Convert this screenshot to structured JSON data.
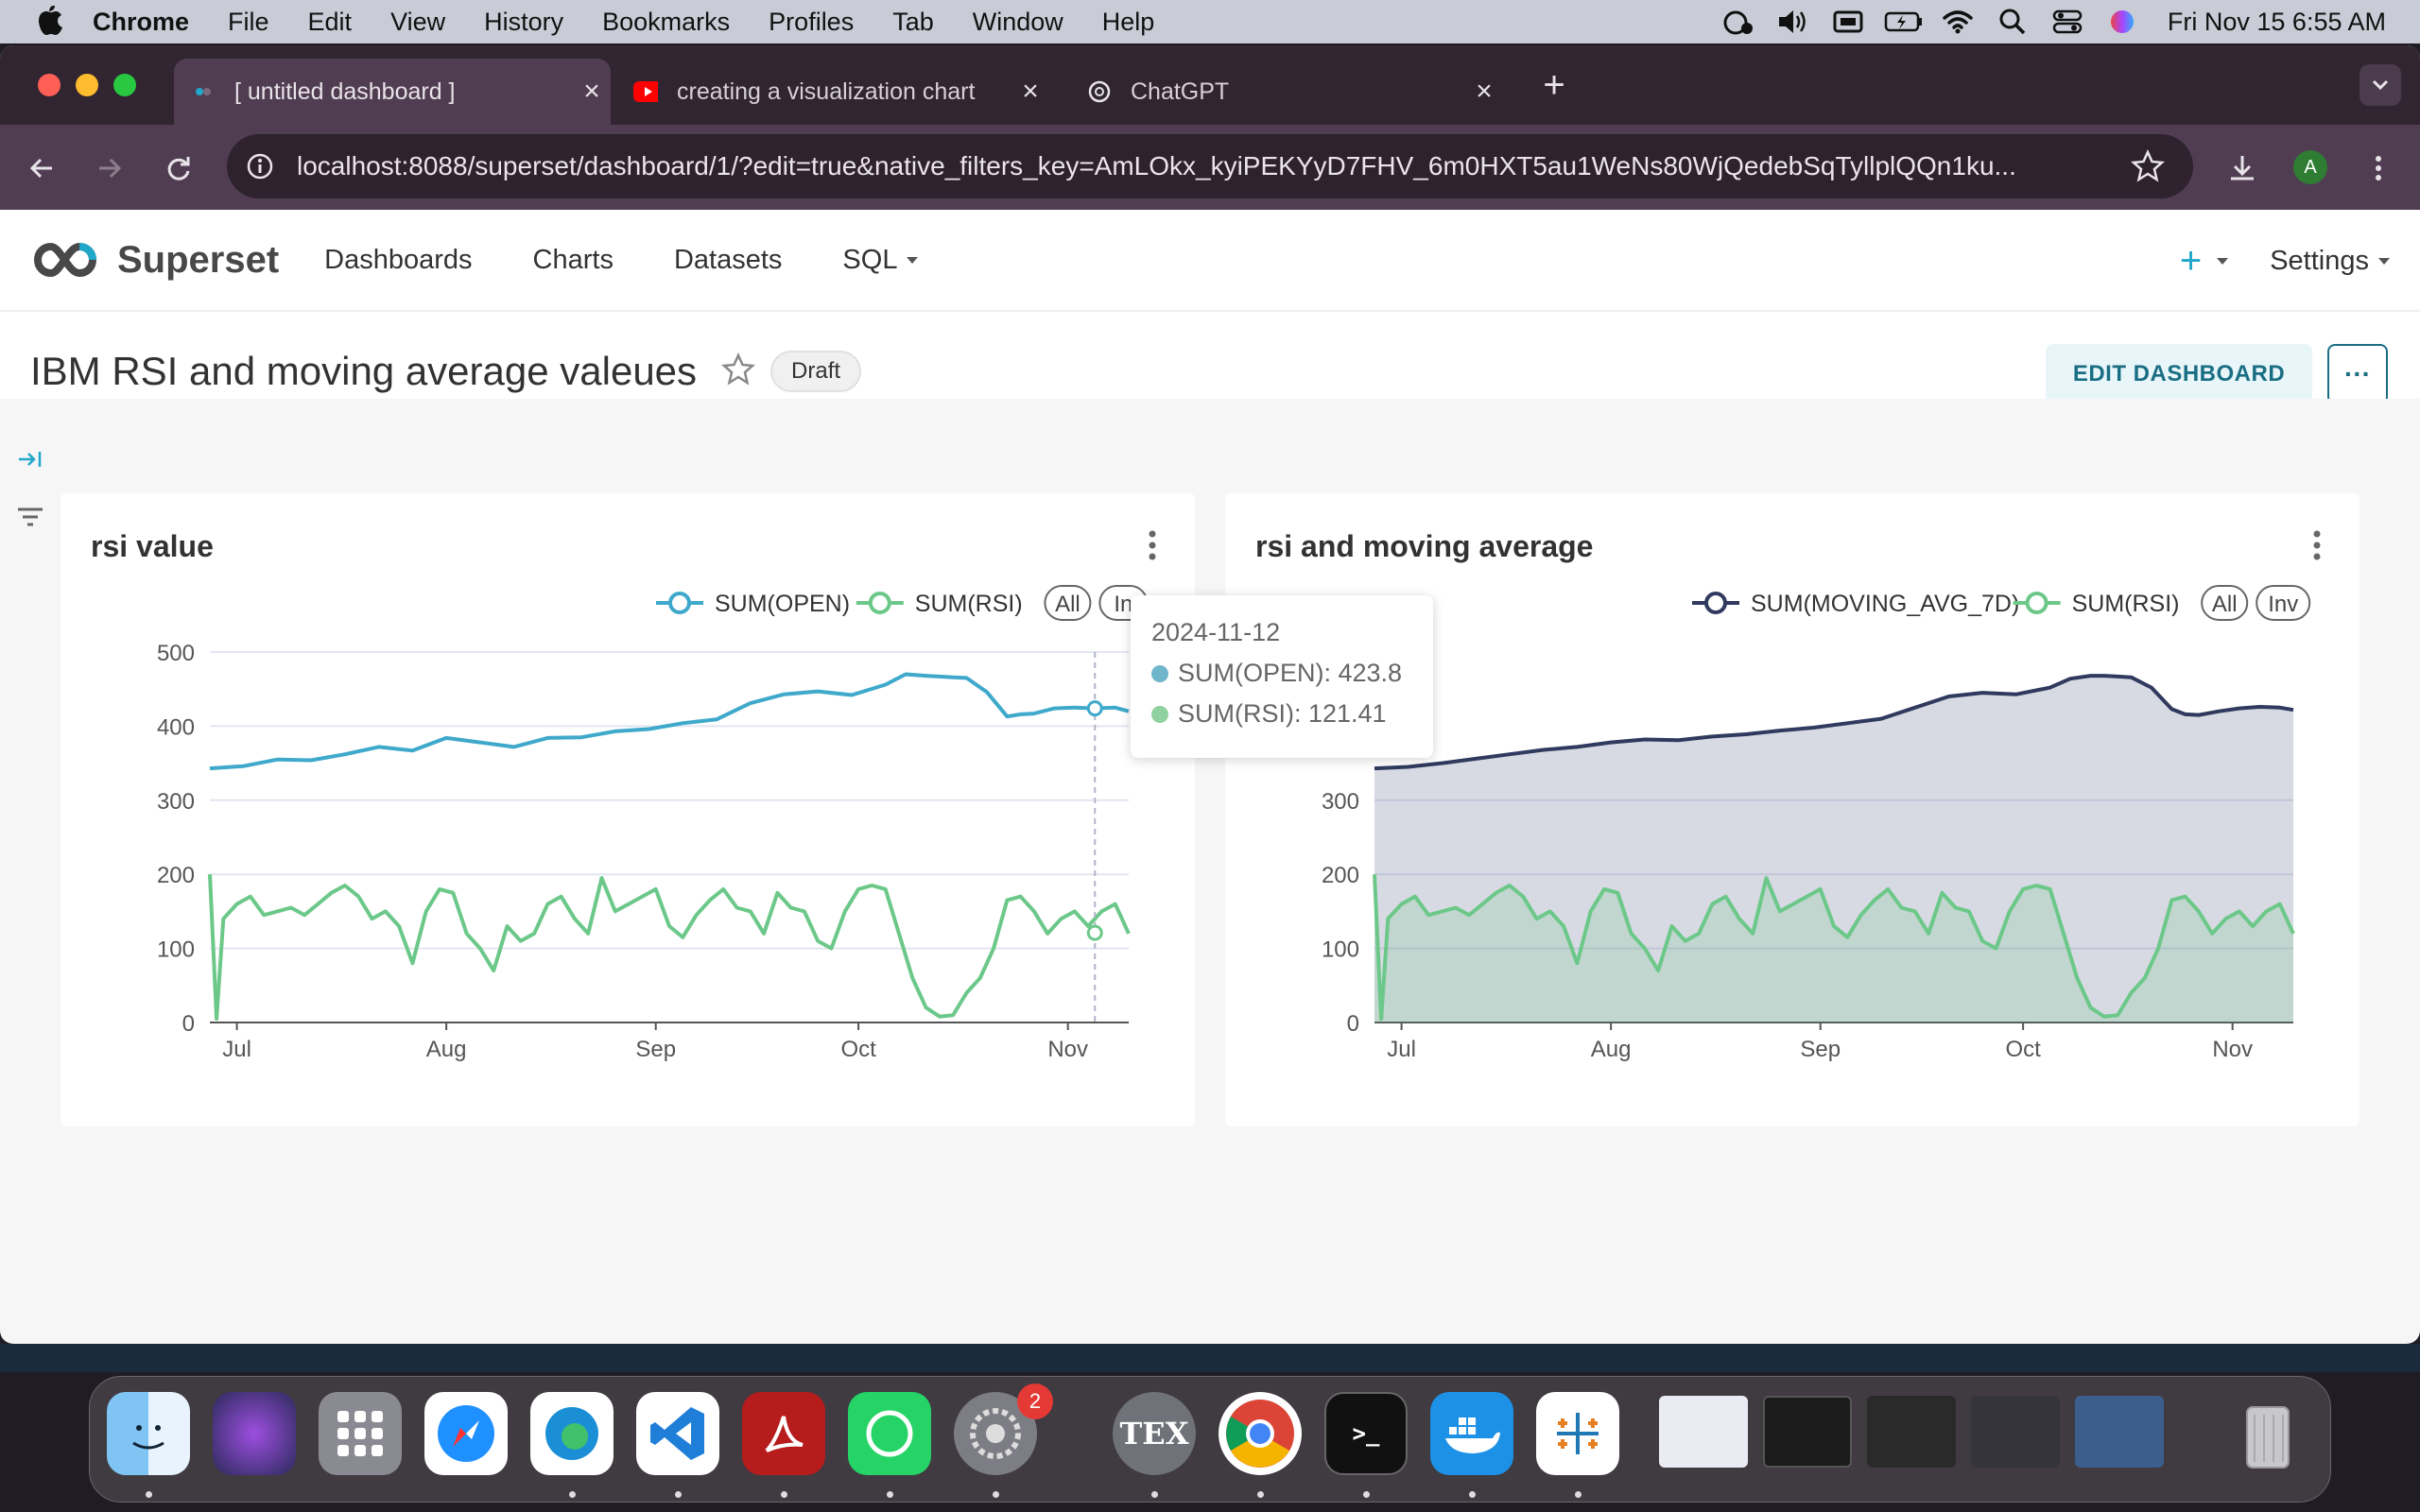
{
  "menubar": {
    "app": "Chrome",
    "items": [
      "File",
      "Edit",
      "View",
      "History",
      "Bookmarks",
      "Profiles",
      "Tab",
      "Window",
      "Help"
    ],
    "clock": "Fri Nov 15  6:55 AM"
  },
  "browser": {
    "tabs": [
      {
        "title": "[ untitled dashboard ]"
      },
      {
        "title": "creating a visualization chart"
      },
      {
        "title": "ChatGPT"
      }
    ],
    "url": "localhost:8088/superset/dashboard/1/?edit=true&native_filters_key=AmLOkx_kyiPEKYyD7FHV_6m0HXT5au1WeNs80WjQedebSqTyllplQQn1ku...",
    "profile_initial": "A"
  },
  "superset": {
    "brand": "Superset",
    "nav": [
      "Dashboards",
      "Charts",
      "Datasets",
      "SQL"
    ],
    "settings": "Settings",
    "plus": "+"
  },
  "dashboard": {
    "title": "IBM RSI and moving average valeues",
    "badge": "Draft",
    "edit_button": "EDIT DASHBOARD",
    "more_button": "···"
  },
  "tooltip": {
    "date": "2024-11-12",
    "open_line": "SUM(OPEN): 423.8",
    "rsi_line": "SUM(RSI): 121.41",
    "open_color": "#6fb5cc",
    "rsi_color": "#8fd1a0"
  },
  "charts": {
    "left": {
      "title": "rsi value",
      "legend": [
        "SUM(OPEN)",
        "SUM(RSI)"
      ],
      "legend_all": "All",
      "legend_inv": "In"
    },
    "right": {
      "title": "rsi and moving average",
      "legend": [
        "SUM(MOVING_AVG_7D)",
        "SUM(RSI)"
      ],
      "legend_all": "All",
      "legend_inv": "Inv"
    }
  },
  "colors": {
    "open": "#3fa9cb",
    "rsi": "#6cc889",
    "mavg": "#2f3a5e",
    "accent": "#20a7c9"
  },
  "chart_data": [
    {
      "type": "line",
      "title": "rsi value",
      "x_ticks": [
        "Jul",
        "Aug",
        "Sep",
        "Oct",
        "Nov"
      ],
      "y_ticks": [
        0,
        100,
        200,
        300,
        400,
        500
      ],
      "ylim": [
        0,
        500
      ],
      "x_range_days": [
        0,
        136
      ],
      "series": [
        {
          "name": "SUM(OPEN)",
          "x": [
            0,
            5,
            10,
            15,
            20,
            25,
            30,
            35,
            40,
            45,
            50,
            55,
            60,
            65,
            70,
            75,
            80,
            85,
            90,
            95,
            100,
            103,
            106,
            108,
            110,
            112,
            115,
            118,
            120,
            122,
            125,
            128,
            131,
            134,
            136
          ],
          "values": [
            343,
            346,
            355,
            354,
            362,
            372,
            367,
            384,
            378,
            372,
            384,
            385,
            393,
            396,
            404,
            409,
            431,
            443,
            447,
            442,
            456,
            470,
            468,
            467,
            466,
            465,
            446,
            413,
            416,
            417,
            424,
            425,
            424,
            425,
            420
          ]
        },
        {
          "name": "SUM(RSI)",
          "x": [
            0,
            1,
            2,
            4,
            6,
            8,
            10,
            12,
            14,
            16,
            18,
            20,
            22,
            24,
            26,
            28,
            30,
            32,
            34,
            36,
            38,
            40,
            42,
            44,
            46,
            48,
            50,
            52,
            54,
            56,
            58,
            60,
            62,
            64,
            66,
            68,
            70,
            72,
            74,
            76,
            78,
            80,
            82,
            84,
            86,
            88,
            90,
            92,
            94,
            96,
            98,
            100,
            102,
            104,
            106,
            108,
            110,
            112,
            114,
            116,
            118,
            120,
            122,
            124,
            126,
            128,
            130,
            132,
            134,
            136
          ],
          "values": [
            200,
            5,
            140,
            160,
            170,
            145,
            150,
            155,
            145,
            160,
            175,
            185,
            170,
            140,
            150,
            130,
            80,
            150,
            180,
            175,
            120,
            100,
            70,
            130,
            110,
            120,
            160,
            170,
            140,
            120,
            195,
            150,
            160,
            170,
            180,
            130,
            115,
            145,
            165,
            180,
            155,
            150,
            120,
            175,
            155,
            150,
            110,
            100,
            150,
            180,
            185,
            180,
            120,
            60,
            20,
            8,
            10,
            40,
            60,
            100,
            165,
            170,
            150,
            120,
            140,
            150,
            130,
            150,
            160,
            120
          ]
        }
      ]
    },
    {
      "type": "area",
      "title": "rsi and moving average",
      "x_ticks": [
        "Jul",
        "Aug",
        "Sep",
        "Oct",
        "Nov"
      ],
      "y_ticks": [
        0,
        100,
        200,
        300
      ],
      "ylim": [
        0,
        500
      ],
      "series": [
        {
          "name": "SUM(MOVING_AVG_7D)",
          "x": [
            0,
            5,
            10,
            15,
            20,
            25,
            30,
            35,
            40,
            45,
            50,
            55,
            60,
            65,
            70,
            75,
            80,
            85,
            90,
            95,
            100,
            103,
            106,
            108,
            110,
            112,
            115,
            118,
            120,
            122,
            125,
            128,
            131,
            134,
            136
          ],
          "values": [
            343,
            345,
            350,
            356,
            362,
            368,
            372,
            378,
            382,
            381,
            386,
            389,
            394,
            398,
            404,
            410,
            425,
            440,
            445,
            443,
            452,
            464,
            468,
            468,
            467,
            466,
            452,
            423,
            416,
            415,
            420,
            424,
            426,
            425,
            422
          ]
        },
        {
          "name": "SUM(RSI)",
          "ref": 0
        }
      ]
    }
  ]
}
